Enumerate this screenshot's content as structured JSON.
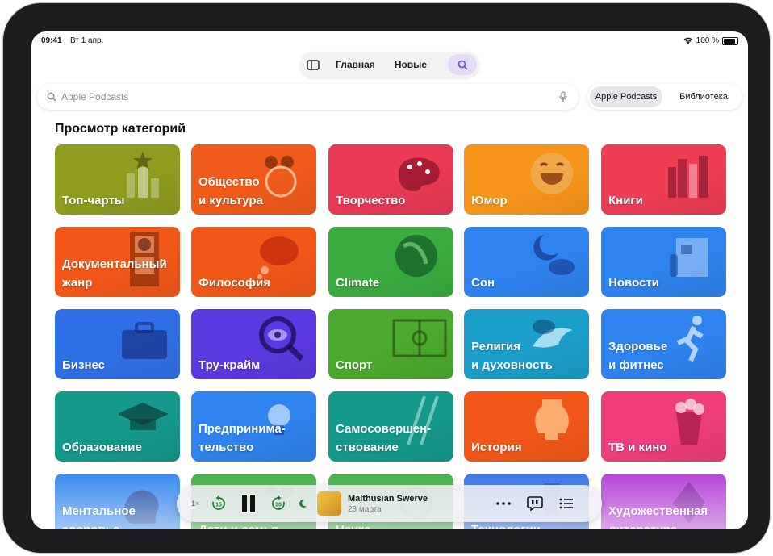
{
  "status": {
    "time": "09:41",
    "date": "Вт 1 апр.",
    "battery": "100 %"
  },
  "tabs": {
    "home": "Главная",
    "new": "Новые"
  },
  "search": {
    "placeholder": "Apple Podcasts"
  },
  "scope": {
    "apple": "Apple Podcasts",
    "library": "Библиотека"
  },
  "heading": "Просмотр категорий",
  "categories": [
    {
      "label": "Топ-чарты",
      "color": "#8f9c1f",
      "icon": "chart-star-icon"
    },
    {
      "label": "Общество\nи культура",
      "color": "#f05a1a",
      "icon": "people-globe-icon"
    },
    {
      "label": "Творчество",
      "color": "#ea3a55",
      "icon": "palette-icon"
    },
    {
      "label": "Юмор",
      "color": "#f7951a",
      "icon": "laughing-face-icon"
    },
    {
      "label": "Книги",
      "color": "#ee3d55",
      "icon": "books-icon"
    },
    {
      "label": "Документальный\nжанр",
      "color": "#f25718",
      "icon": "film-strip-icon"
    },
    {
      "label": "Философия",
      "color": "#f25718",
      "icon": "thought-bubble-icon"
    },
    {
      "label": "Climate",
      "color": "#3aab3f",
      "icon": "earth-icon"
    },
    {
      "label": "Сон",
      "color": "#2f83ee",
      "icon": "moon-clouds-icon"
    },
    {
      "label": "Новости",
      "color": "#2f83ee",
      "icon": "newspaper-icon"
    },
    {
      "label": "Бизнес",
      "color": "#2f6fe6",
      "icon": "briefcase-icon"
    },
    {
      "label": "Тру-крайм",
      "color": "#5b39e0",
      "icon": "magnifier-eye-icon"
    },
    {
      "label": "Спорт",
      "color": "#4ba92d",
      "icon": "soccer-field-icon"
    },
    {
      "label": "Религия\nи духовность",
      "color": "#1b9ec9",
      "icon": "dove-icon"
    },
    {
      "label": "Здоровье\nи фитнес",
      "color": "#2f83ee",
      "icon": "runner-icon"
    },
    {
      "label": "Образование",
      "color": "#14998a",
      "icon": "graduation-cap-icon"
    },
    {
      "label": "Предпринима-\nтельство",
      "color": "#2f83ee",
      "icon": "lightbulb-icon"
    },
    {
      "label": "Самосовершен-\nствование",
      "color": "#14998a",
      "icon": "ladder-icon"
    },
    {
      "label": "История",
      "color": "#f25718",
      "icon": "amphora-icon"
    },
    {
      "label": "ТВ и кино",
      "color": "#ee3d7a",
      "icon": "popcorn-icon"
    },
    {
      "label": "Ментальное\nздоровье",
      "color": "#2f83ee",
      "icon": "head-icon"
    },
    {
      "label": "Дети и семья",
      "color": "#3aab3f",
      "icon": "family-icon"
    },
    {
      "label": "Наука",
      "color": "#3aab3f",
      "icon": "science-icon"
    },
    {
      "label": "Технологии",
      "color": "#2f6fe6",
      "icon": "circuit-icon"
    },
    {
      "label": "Художественная\nлитература",
      "color": "#b23ad6",
      "icon": "pen-nib-icon"
    }
  ],
  "player": {
    "speed": "1×",
    "skip_back": "15",
    "skip_forward": "30",
    "episode_title": "Malthusian Swerve",
    "episode_date": "28 марта"
  }
}
